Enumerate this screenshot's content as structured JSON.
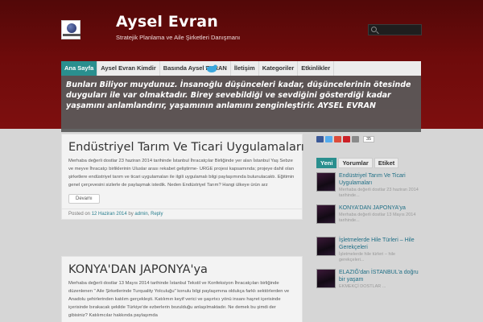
{
  "site": {
    "title": "Aysel Evran",
    "description": "Stratejik Planlama ve Aile Şirketleri Danışmanı",
    "logo_icon": "logo-globe-icon"
  },
  "search": {
    "placeholder": ""
  },
  "nav": {
    "items": [
      {
        "label": "Ana Sayfa",
        "active": true
      },
      {
        "label": "Aysel Evran Kimdir",
        "active": false
      },
      {
        "label": "Basında Aysel EVRAN",
        "active": false
      },
      {
        "label": "İletişim",
        "active": false
      },
      {
        "label": "Kategoriler",
        "active": false
      },
      {
        "label": "Etkinlikler",
        "active": false
      }
    ]
  },
  "banner": {
    "text": "Bunları Biliyor muydunuz. İnsanoğlu düşünceleri kadar, düşüncelerinin ötesinde duyguları ile var olmaktadır. Birey sevebildiği ve sevdiğini gösterdiği kadar yaşamını anlamlandırır, yaşamının anlamını zenginleştirir. AYSEL EVRAN"
  },
  "posts": [
    {
      "title": "Endüstriyel Tarım Ve Ticari Uygulamaları",
      "excerpt": "Merhaba değerli dostlar 23 haziran 2014 tarihinde İstanbul İhracatçılar Birliğinde yer alan İstanbul Yaş Sebze ve meyve İhracatçı birliklerinin Uluslar arası rekabet geliştirme- URGE projesi kapsamında; projeye dahil olan şirketlere endüstriyel tarım ve ticari uygulamaları ile ilgili uygulamalı bilgi paylaşımında bulunulacaktı. Eğitimin genel çerçevesini sizlerle de paylaşmak istedik. Neden Endüstriyel Tarım? Hangi ülkeye ürün arz",
      "read_more": "Devamı",
      "meta_prefix": "Posted on",
      "date": "12 Haziran 2014",
      "meta_by": "by",
      "author": "admin",
      "reply": "Reply"
    },
    {
      "title": "KONYA'DAN JAPONYA'ya",
      "excerpt": "Merhaba değerli dostlar 13 Mayıs 2014 tarihinde İstanbul Tekstil ve Konfeksiyon İhracatçıları birliğinde düzenlenen \" Aile Şirketlerinde Turquality Yolculuğu\" konulu bilgi paylaşımına oldukça farklı sektörlerden ve Anadolu şehirlerinden katılım gerçekleşti. Katılımın keyif verici ve şaşırtıcı yönü insanı hayret içerisinde içerisinde bırakacak şekilde Türkiye'de ezberlerin bozulduğu anlaşılmaktadır. Ne demek bu şimdi der gibisiniz? Katılımcılar hakkında paylaşımda"
    }
  ],
  "share": {
    "count": "35",
    "buttons": [
      {
        "name": "share-facebook-icon",
        "color": "#3b5998"
      },
      {
        "name": "share-twitter-icon",
        "color": "#55acee"
      },
      {
        "name": "share-googleplus-icon",
        "color": "#dd4b39"
      },
      {
        "name": "share-pinterest-icon",
        "color": "#cb2027"
      },
      {
        "name": "share-more-icon",
        "color": "#8a8a8a"
      }
    ]
  },
  "sidebar": {
    "tabs": [
      {
        "label": "Yeni",
        "active": true
      },
      {
        "label": "Yorumlar",
        "active": false
      },
      {
        "label": "Etiket",
        "active": false
      }
    ],
    "items": [
      {
        "title": "Endüstriyel Tarım Ve Ticari Uygulamaları",
        "snippet": "Merhaba değerli dostlar 23 haziran 2014 tarihinde..."
      },
      {
        "title": "KONYA'DAN JAPONYA'ya",
        "snippet": "Merhaba değerli dostlar 13 Mayıs 2014 tarihinde..."
      },
      {
        "title": "İşletmelerde Hile Türleri – Hile Gerekçeleri",
        "snippet": "İşletmelerde hile türleri – hile gerekçeleri..."
      },
      {
        "title": "ELAZIĞ'dan İSTANBUL'a doğru bir yaşam",
        "snippet": "EKMEKÇİ DOSTLAR ..."
      }
    ]
  },
  "colors": {
    "header_bg": "#6e0b0b",
    "accent": "#2a8f8e",
    "body_bg": "#d6d6d6"
  }
}
